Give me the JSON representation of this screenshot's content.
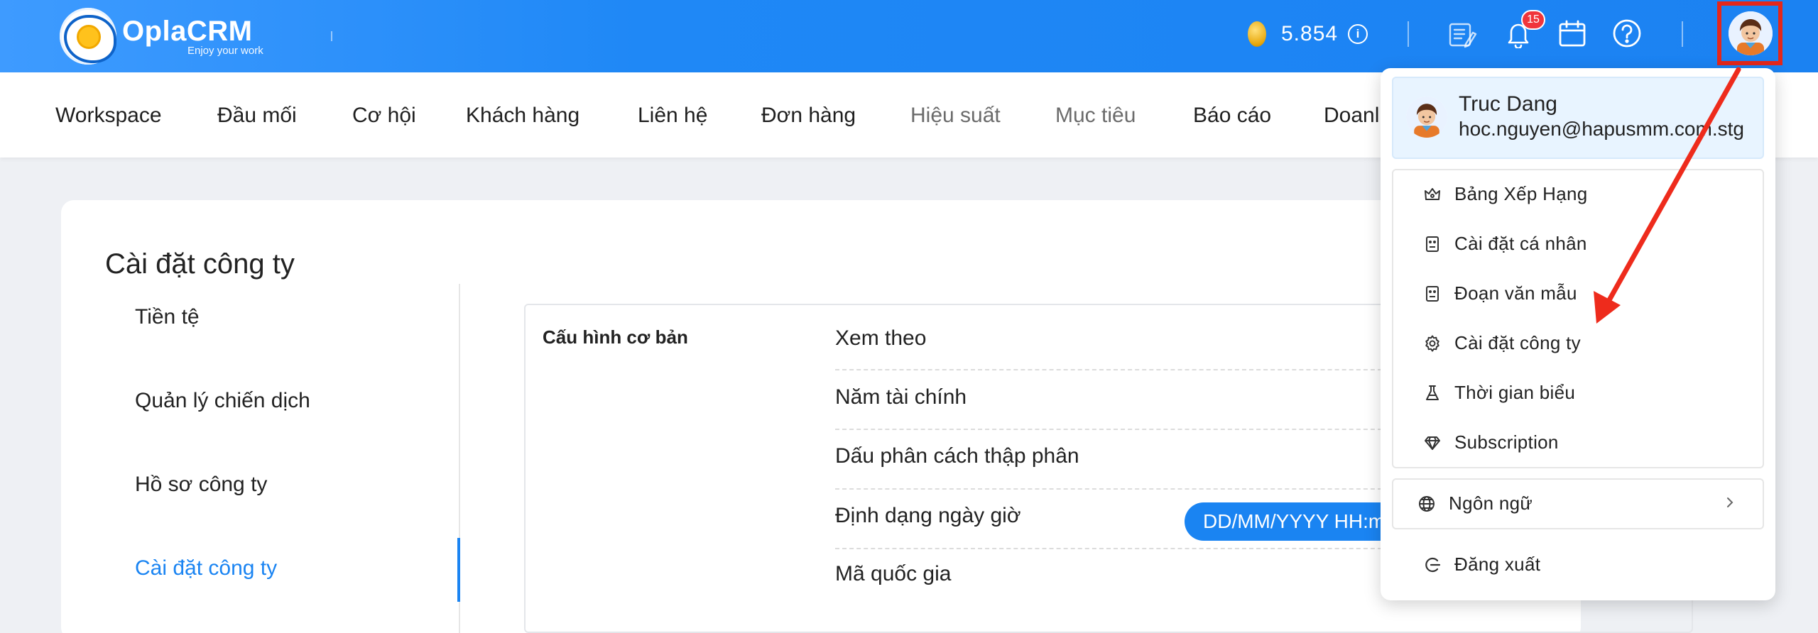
{
  "header": {
    "brand": "OplaCRM",
    "tagline": "Enjoy your work",
    "coins": "5.854",
    "notification_count": "15"
  },
  "nav": {
    "items": [
      {
        "label": "Workspace"
      },
      {
        "label": "Đầu mối"
      },
      {
        "label": "Cơ hội"
      },
      {
        "label": "Khách hàng"
      },
      {
        "label": "Liên hệ"
      },
      {
        "label": "Đơn hàng"
      },
      {
        "label": "Hiệu suất"
      },
      {
        "label": "Mục tiêu"
      },
      {
        "label": "Báo cáo"
      },
      {
        "label": "Doanl"
      }
    ]
  },
  "page": {
    "title": "Cài đặt công ty",
    "sidebar": [
      {
        "label": "Tiền tệ"
      },
      {
        "label": "Quản lý chiến dịch"
      },
      {
        "label": "Hồ sơ công ty"
      },
      {
        "label": "Cài đặt công ty"
      }
    ],
    "section_title": "Cấu hình cơ bản",
    "rows": [
      {
        "label": "Xem theo"
      },
      {
        "label": "Năm tài chính"
      },
      {
        "label": "Dấu phân cách thập phân"
      },
      {
        "label": "Định dạng ngày giờ"
      },
      {
        "label": "Mã quốc gia"
      }
    ],
    "date_format_value": "DD/MM/YYYY HH:mm"
  },
  "dropdown": {
    "user_name": "Truc Dang",
    "user_email": "hoc.nguyen@hapusmm.com.stg",
    "items": [
      {
        "label": "Bảng Xếp Hạng",
        "icon": "ranking-crown-icon"
      },
      {
        "label": "Cài đặt cá nhân",
        "icon": "personal-settings-icon"
      },
      {
        "label": "Đoạn văn mẫu",
        "icon": "template-text-icon"
      },
      {
        "label": "Cài đặt công ty",
        "icon": "gear-icon"
      },
      {
        "label": "Thời gian biểu",
        "icon": "flask-icon"
      },
      {
        "label": "Subscription",
        "icon": "diamond-icon"
      }
    ],
    "language_label": "Ngôn ngữ",
    "logout_label": "Đăng xuất"
  },
  "colors": {
    "header_blue": "#1b82f2",
    "accent_blue": "#1a84f2",
    "highlight_red": "#e4271b"
  }
}
